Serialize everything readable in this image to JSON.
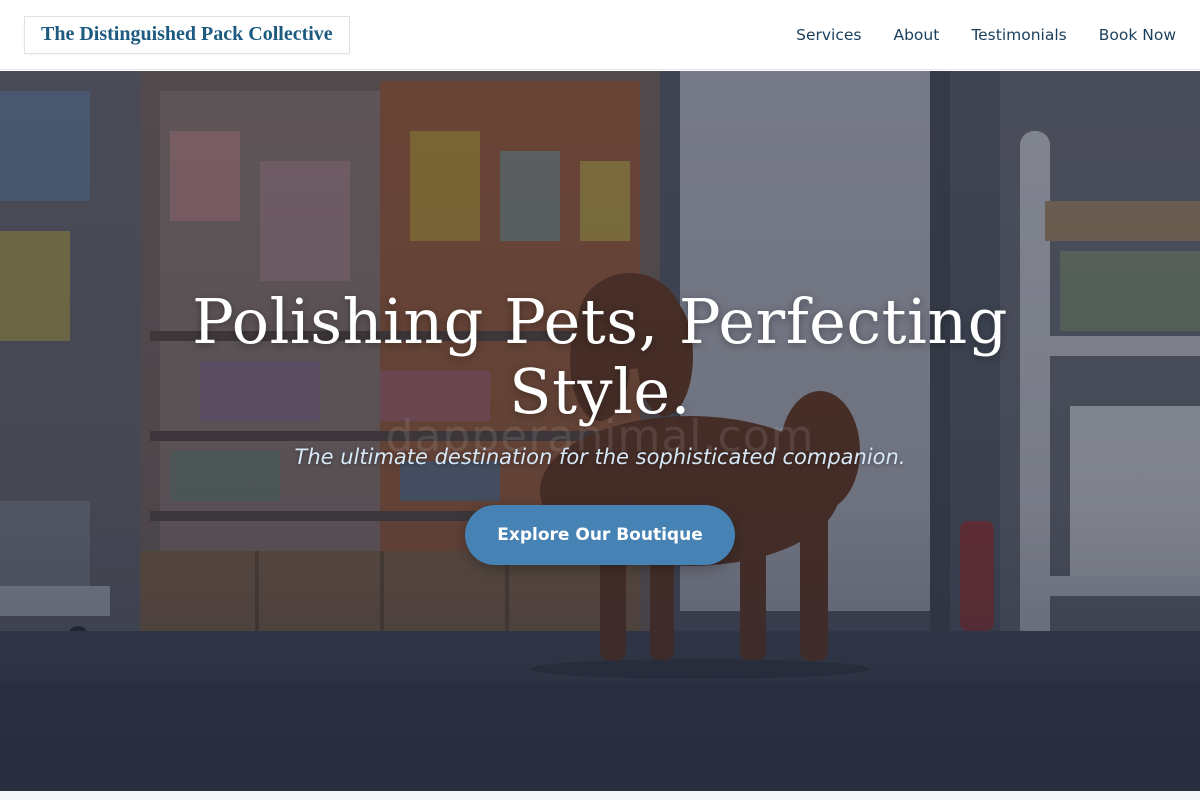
{
  "header": {
    "logo": "The Distinguished Pack Collective",
    "nav": [
      {
        "label": "Services"
      },
      {
        "label": "About"
      },
      {
        "label": "Testimonials"
      },
      {
        "label": "Book Now"
      }
    ]
  },
  "hero": {
    "title": "Polishing Pets, Perfecting Style.",
    "subtitle": "The ultimate destination for the sophisticated companion.",
    "cta_label": "Explore Our Boutique",
    "watermark": "dapperanimal.com",
    "background_image": "dog-in-pet-boutique-photo"
  },
  "colors": {
    "brand": "#1c5a80",
    "nav_text": "#1a3f5c",
    "cta": "#4682b4",
    "subtitle": "#d6e8f6"
  }
}
